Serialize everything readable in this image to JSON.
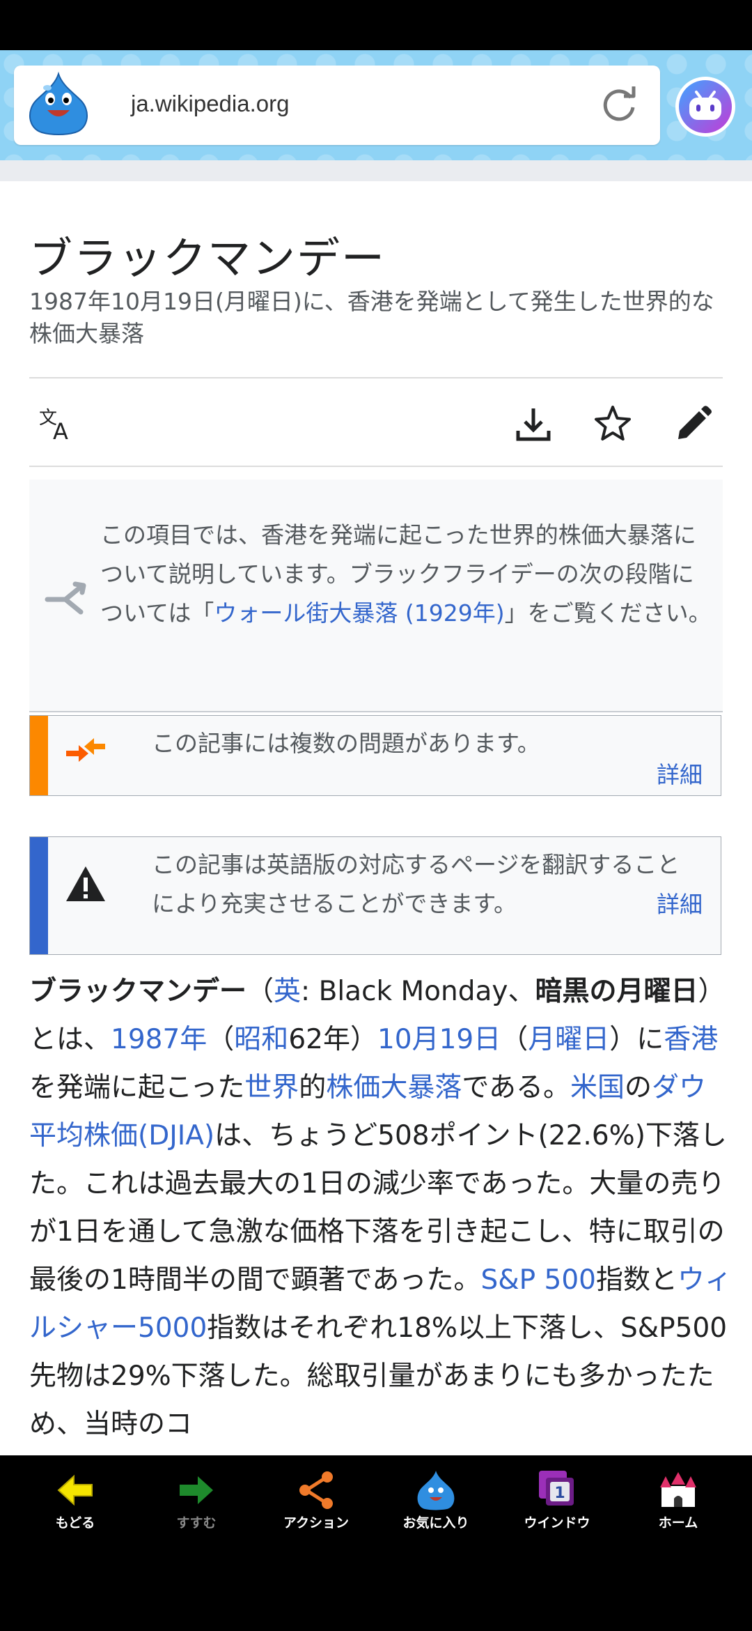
{
  "browser": {
    "url": "ja.wikipedia.org"
  },
  "article": {
    "title": "ブラックマンデー",
    "subtitle": "1987年10月19日(月曜日)に、香港を発端として発生した世界的な株価大暴落"
  },
  "hatnote": {
    "text_before": "この項目では、香港を発端に起こった世界的株価大暴落について説明しています。ブラックフライデーの次の段階については「",
    "link": "ウォール街大暴落 (1929年)",
    "text_after": "」をご覧ください。"
  },
  "notices": [
    {
      "text": "この記事には複数の問題があります。",
      "more": "詳細",
      "color": "#fc8800"
    },
    {
      "text": "この記事は英語版の対応するページを翻訳することにより充実させることができます。",
      "more": "詳細",
      "color": "#3366cc"
    }
  ],
  "body": {
    "p1": "ブラックマンデー",
    "p2": "（",
    "p3": "英",
    "p4": ": Black Monday、",
    "p5": "暗黒の月曜日",
    "p6": "）とは、",
    "p7": "1987年",
    "p8": "（",
    "p9": "昭和",
    "p10": "62年）",
    "p11": "10月19日",
    "p12": "（",
    "p13": "月曜日",
    "p14": "）に",
    "p15": "香港",
    "p16": "を発端に起こった",
    "p17": "世界",
    "p18": "的",
    "p19": "株価大暴落",
    "p20": "である。",
    "p21": "米国",
    "p22": "の",
    "p23": "ダウ平均株価(DJIA)",
    "p24": "は、ちょうど508ポイント(22.6%)下落した。これは過去最大の1日の減少率であった。大量の売りが1日を通して急激な価格下落を引き起こし、特に取引の最後の1時間半の間で顕著であった。",
    "p25": "S&P 500",
    "p26": "指数と",
    "p27": "ウィルシャー5000",
    "p28": "指数はそれぞれ18%以上下落し、S&P500先物は29%下落した。総取引量があまりにも多かったため、当時のコ"
  },
  "bottom_nav": [
    {
      "label": "もどる",
      "icon": "back-arrow-icon",
      "color": "#f5e400"
    },
    {
      "label": "すすむ",
      "icon": "forward-arrow-icon",
      "color": "#1e8a2c"
    },
    {
      "label": "アクション",
      "icon": "share-icon",
      "color": "#f07a2a"
    },
    {
      "label": "お気に入り",
      "icon": "slime-icon",
      "color": "#2f8ee0"
    },
    {
      "label": "ウインドウ",
      "icon": "window-icon",
      "color": "#9b2fb8",
      "badge": "1"
    },
    {
      "label": "ホーム",
      "icon": "castle-icon",
      "color": "#e0306a"
    }
  ]
}
